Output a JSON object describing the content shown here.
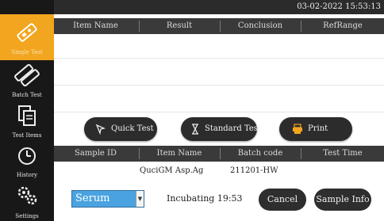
{
  "topbar": {
    "datetime": "03-02-2022 15:53:13"
  },
  "sidebar": {
    "items": [
      {
        "label": "Single Test",
        "icon": "single-test-icon",
        "active": true
      },
      {
        "label": "Batch Test",
        "icon": "batch-test-icon",
        "active": false
      },
      {
        "label": "Test Items",
        "icon": "test-items-icon",
        "active": false
      },
      {
        "label": "History",
        "icon": "clock-icon",
        "active": false
      },
      {
        "label": "Settings",
        "icon": "gear-icon",
        "active": false
      }
    ]
  },
  "result_table": {
    "headers": [
      "Item Name",
      "Result",
      "Conclusion",
      "RefRange"
    ]
  },
  "actions": {
    "quick_test": "Quick Test",
    "standard_test": "Standard Test",
    "print": "Print"
  },
  "sample_table": {
    "headers": [
      "Sample ID",
      "Item Name",
      "Batch code",
      "Test Time"
    ],
    "rows": [
      {
        "sample_id": "",
        "item_name": "QuciGM Asp.Ag",
        "batch_code": "211201-HW",
        "test_time": ""
      }
    ]
  },
  "controls": {
    "sample_type": "Serum",
    "status": "Incubating 19:53",
    "cancel": "Cancel",
    "sample_info": "Sample Info"
  },
  "colors": {
    "accent": "#f2a51e",
    "select": "#4aa3e0",
    "dark": "#1a1a1a"
  }
}
